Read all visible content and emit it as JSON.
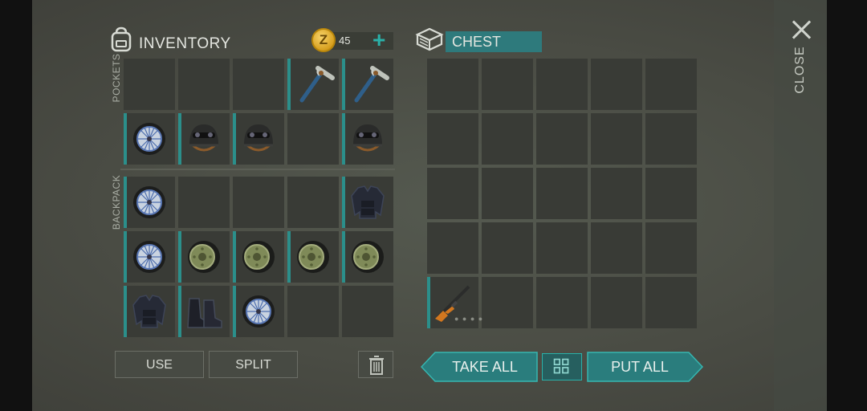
{
  "inventory": {
    "title": "INVENTORY",
    "pockets_label": "POCKETS",
    "backpack_label": "BACKPACK",
    "icon": "backpack-icon"
  },
  "currency": {
    "amount": "45",
    "coin_glyph": "Z",
    "icon": "coin-icon",
    "add_icon": "plus-icon"
  },
  "chest": {
    "title": "CHEST",
    "icon": "chest-icon"
  },
  "close": {
    "label": "CLOSE",
    "icon": "close-icon"
  },
  "pockets": [
    [
      "",
      "",
      "",
      "pickaxe",
      "pickaxe"
    ],
    [
      "wheel",
      "helmet",
      "helmet",
      "",
      "helmet"
    ]
  ],
  "backpack": [
    [
      "wheel",
      "",
      "",
      "",
      "jacket"
    ],
    [
      "wheel",
      "tire",
      "tire",
      "tire",
      "tire"
    ],
    [
      "jacket",
      "boots",
      "wheel",
      "",
      ""
    ]
  ],
  "chest_slots": [
    [
      "",
      "",
      "",
      "",
      ""
    ],
    [
      "",
      "",
      "",
      "",
      ""
    ],
    [
      "",
      "",
      "",
      "",
      ""
    ],
    [
      "",
      "",
      "",
      "",
      ""
    ],
    [
      "rifle",
      "",
      "",
      "",
      ""
    ]
  ],
  "buttons": {
    "use": "USE",
    "split": "SPLIT",
    "take_all": "TAKE ALL",
    "put_all": "PUT ALL",
    "trash_icon": "trash-icon",
    "sort_icon": "grid-sort-icon"
  },
  "colors": {
    "accent_teal": "#2b8f8b",
    "slot_bg": "#393b36",
    "panel_bg": "#4a4c44"
  }
}
